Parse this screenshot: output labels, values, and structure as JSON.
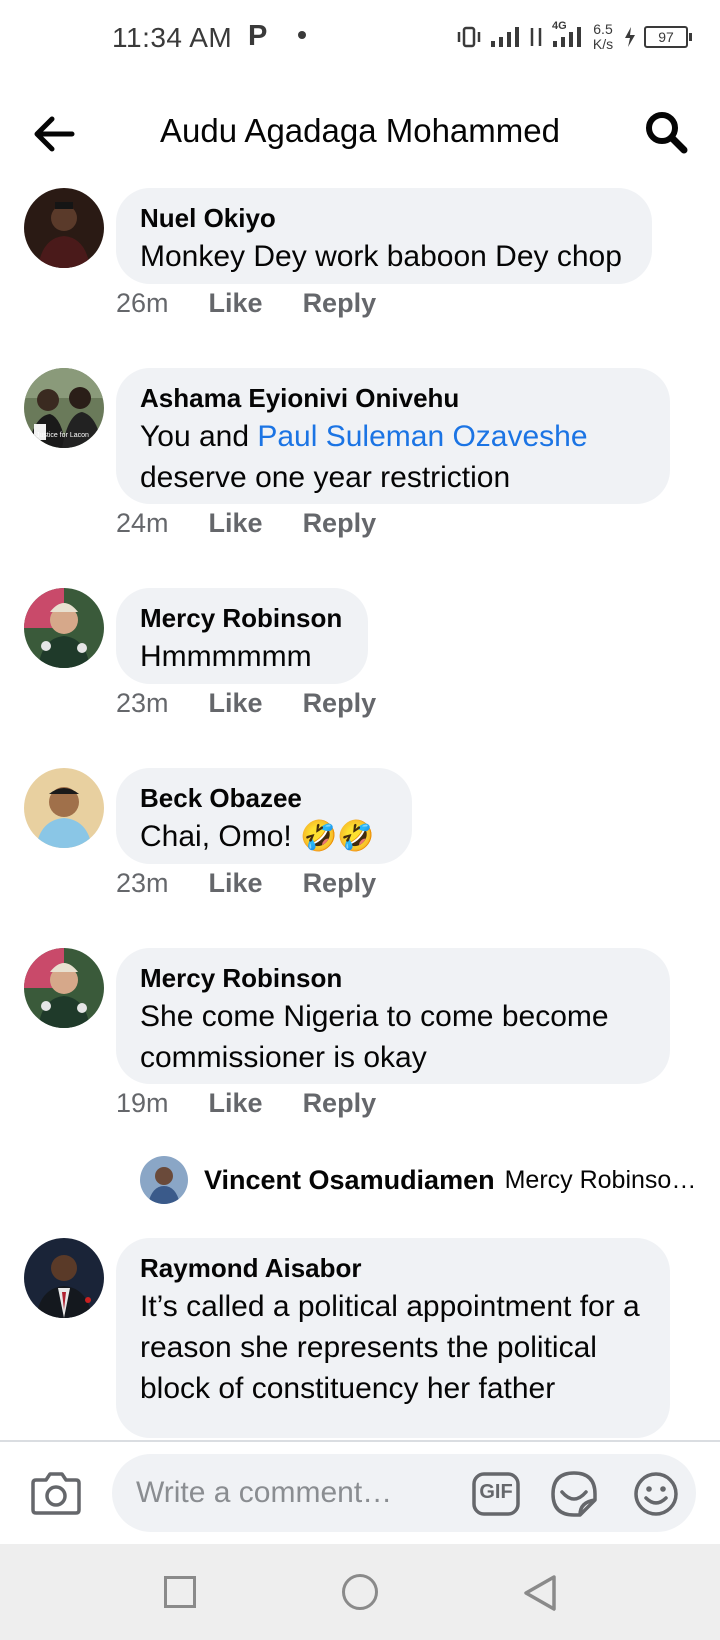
{
  "status_bar": {
    "time": "11:34 AM",
    "p_icon": "P",
    "network_speed": "6.5",
    "network_unit": "K/s",
    "network_type": "4G",
    "battery": "97"
  },
  "header": {
    "title": "Audu Agadaga Mohammed",
    "back_icon": "arrow-left-icon",
    "search_icon": "search-icon"
  },
  "comments": [
    {
      "author": "Nuel Okiyo",
      "text": "Monkey Dey work baboon Dey chop",
      "time": "26m",
      "like": "Like",
      "reply": "Reply"
    },
    {
      "author": "Ashama Eyionivi Onivehu",
      "text_before": "You and ",
      "mention": "Paul Suleman Ozaveshe",
      "text_after": "deserve one year restriction",
      "time": "24m",
      "like": "Like",
      "reply": "Reply",
      "avatar_caption": "Justice for Lacon"
    },
    {
      "author": "Mercy Robinson",
      "text": "Hmmmmmm",
      "time": "23m",
      "like": "Like",
      "reply": "Reply"
    },
    {
      "author": "Beck Obazee",
      "text": "Chai, Omo! 🤣🤣",
      "time": "23m",
      "like": "Like",
      "reply": "Reply"
    },
    {
      "author": "Mercy Robinson",
      "text": "She come Nigeria to come become commissioner is okay",
      "time": "19m",
      "like": "Like",
      "reply": "Reply"
    },
    {
      "author": "Raymond Aisabor",
      "text": "It’s called a political appointment for a reason she represents the political block of constituency her father"
    }
  ],
  "reply_preview": {
    "author": "Vincent Osamudiamen",
    "snippet": "Mercy Robinso…"
  },
  "composer": {
    "placeholder": "Write a comment…",
    "gif_label": "GIF"
  },
  "colors": {
    "bubble": "#f0f2f5",
    "mention": "#1b74e4",
    "meta": "#65676b"
  }
}
